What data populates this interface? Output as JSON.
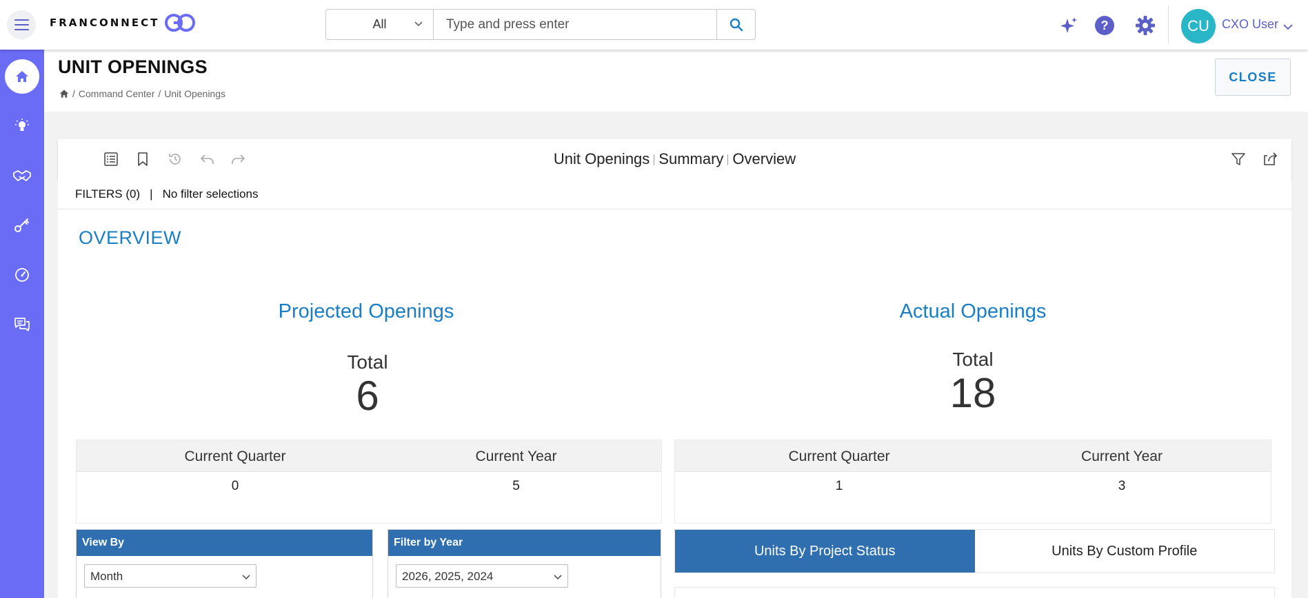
{
  "app": {
    "logo_text": "FRANCONNECT",
    "logo_suffix": "GO"
  },
  "search": {
    "category": "All",
    "placeholder": "Type and press enter"
  },
  "user": {
    "initials": "CU",
    "name": "CXO User"
  },
  "sidebar": {
    "items": [
      {
        "icon": "home-icon",
        "active": true
      },
      {
        "icon": "lightbulb-icon",
        "active": false
      },
      {
        "icon": "handshake-icon",
        "active": false
      },
      {
        "icon": "key-icon",
        "active": false
      },
      {
        "icon": "speedometer-icon",
        "active": false
      },
      {
        "icon": "chat-icon",
        "active": false
      }
    ]
  },
  "page": {
    "title": "UNIT OPENINGS",
    "breadcrumb": [
      "Command Center",
      "Unit Openings"
    ],
    "close_label": "CLOSE"
  },
  "toolbar": {
    "crumbs": [
      "Unit Openings",
      "Summary",
      "Overview"
    ]
  },
  "filters": {
    "label": "FILTERS (0)",
    "separator": "|",
    "text": "No filter selections"
  },
  "overview": {
    "heading": "OVERVIEW",
    "projected": {
      "title": "Projected Openings",
      "total_label": "Total",
      "total": "6",
      "quarter_label": "Current Quarter",
      "quarter_value": "0",
      "year_label": "Current Year",
      "year_value": "5"
    },
    "actual": {
      "title": "Actual Openings",
      "total_label": "Total",
      "total": "18",
      "quarter_label": "Current Quarter",
      "quarter_value": "1",
      "year_label": "Current Year",
      "year_value": "3"
    }
  },
  "view_by": {
    "label": "View By",
    "selected": "Month"
  },
  "filter_year": {
    "label": "Filter by Year",
    "selected": "2026, 2025, 2024"
  },
  "tabs": [
    {
      "label": "Units By Project Status",
      "active": true
    },
    {
      "label": "Units By Custom Profile",
      "active": false
    }
  ],
  "colors": {
    "accent": "#6a6cf6",
    "link_blue": "#1a7ec6",
    "panel_blue": "#2f6faf",
    "avatar": "#29b6c6"
  }
}
